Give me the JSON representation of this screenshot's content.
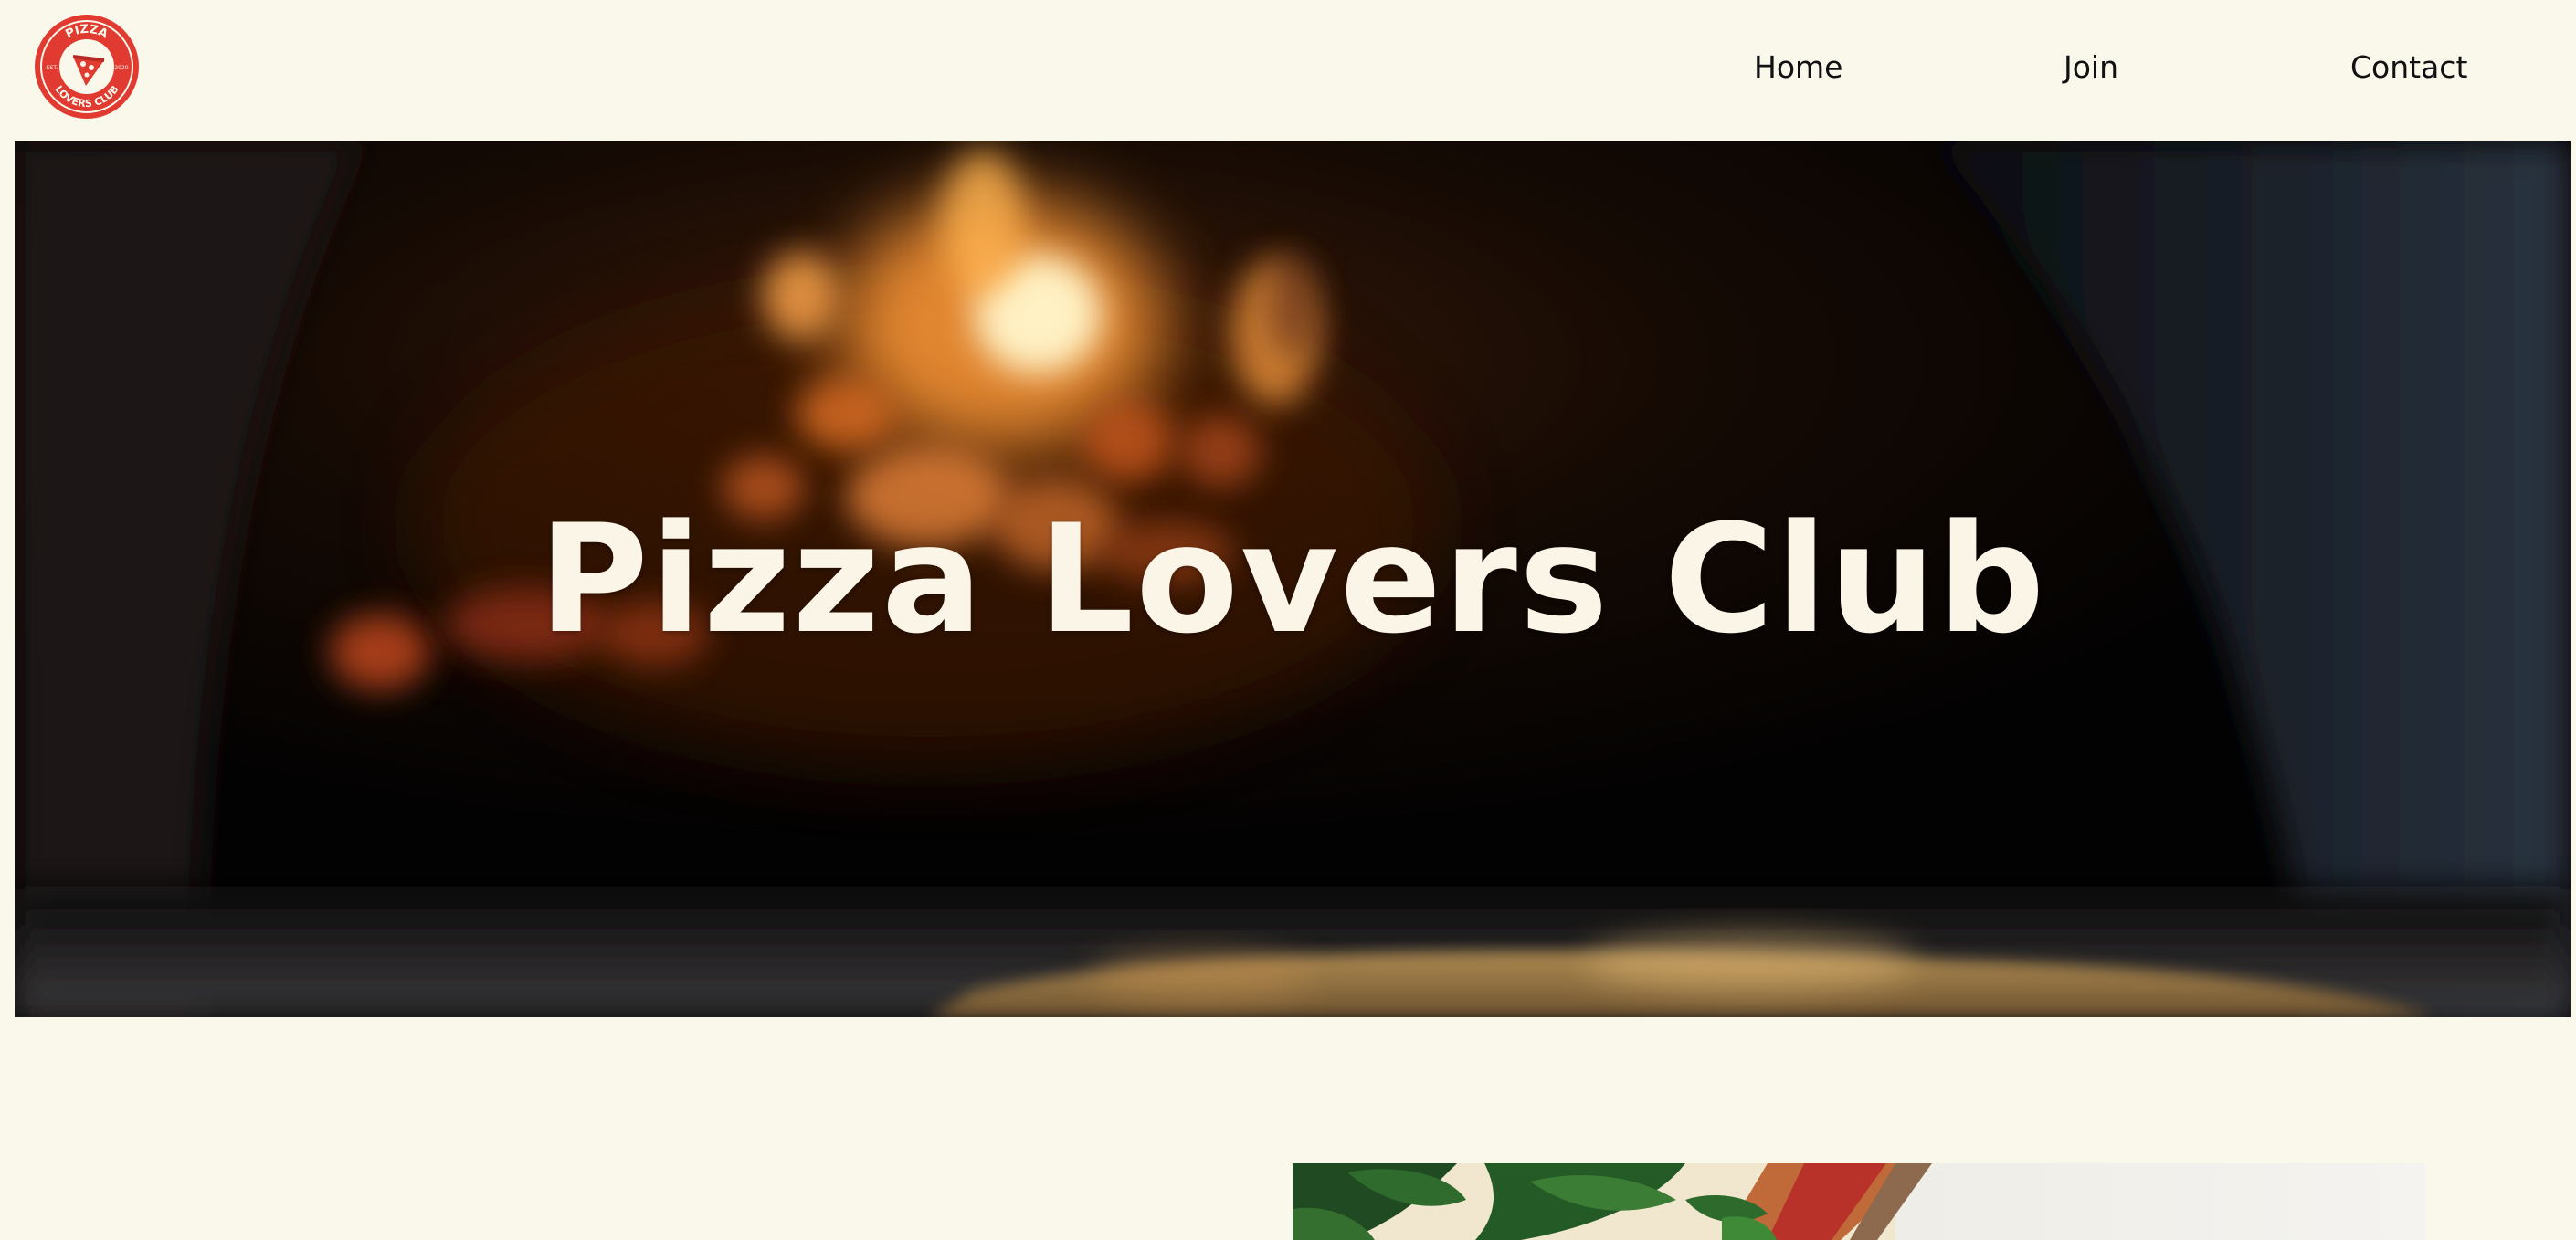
{
  "logo": {
    "alt": "Pizza Lovers Club logo",
    "top_text": "PIZZA",
    "bottom_text": "LOVERS CLUB",
    "left_year": "EST.",
    "right_year": "2020",
    "color": "#e03a31"
  },
  "nav": {
    "items": [
      {
        "label": "Home"
      },
      {
        "label": "Join"
      },
      {
        "label": "Contact"
      }
    ]
  },
  "hero": {
    "title": "Pizza Lovers Club",
    "image_subject": "wood-fired pizza oven with flames"
  },
  "feature": {
    "image_subject": "pizza with fresh basil leaves"
  },
  "colors": {
    "background": "#faf7eb",
    "title_text": "#faf5e6",
    "nav_text": "#111111",
    "logo_red": "#e03a31"
  }
}
